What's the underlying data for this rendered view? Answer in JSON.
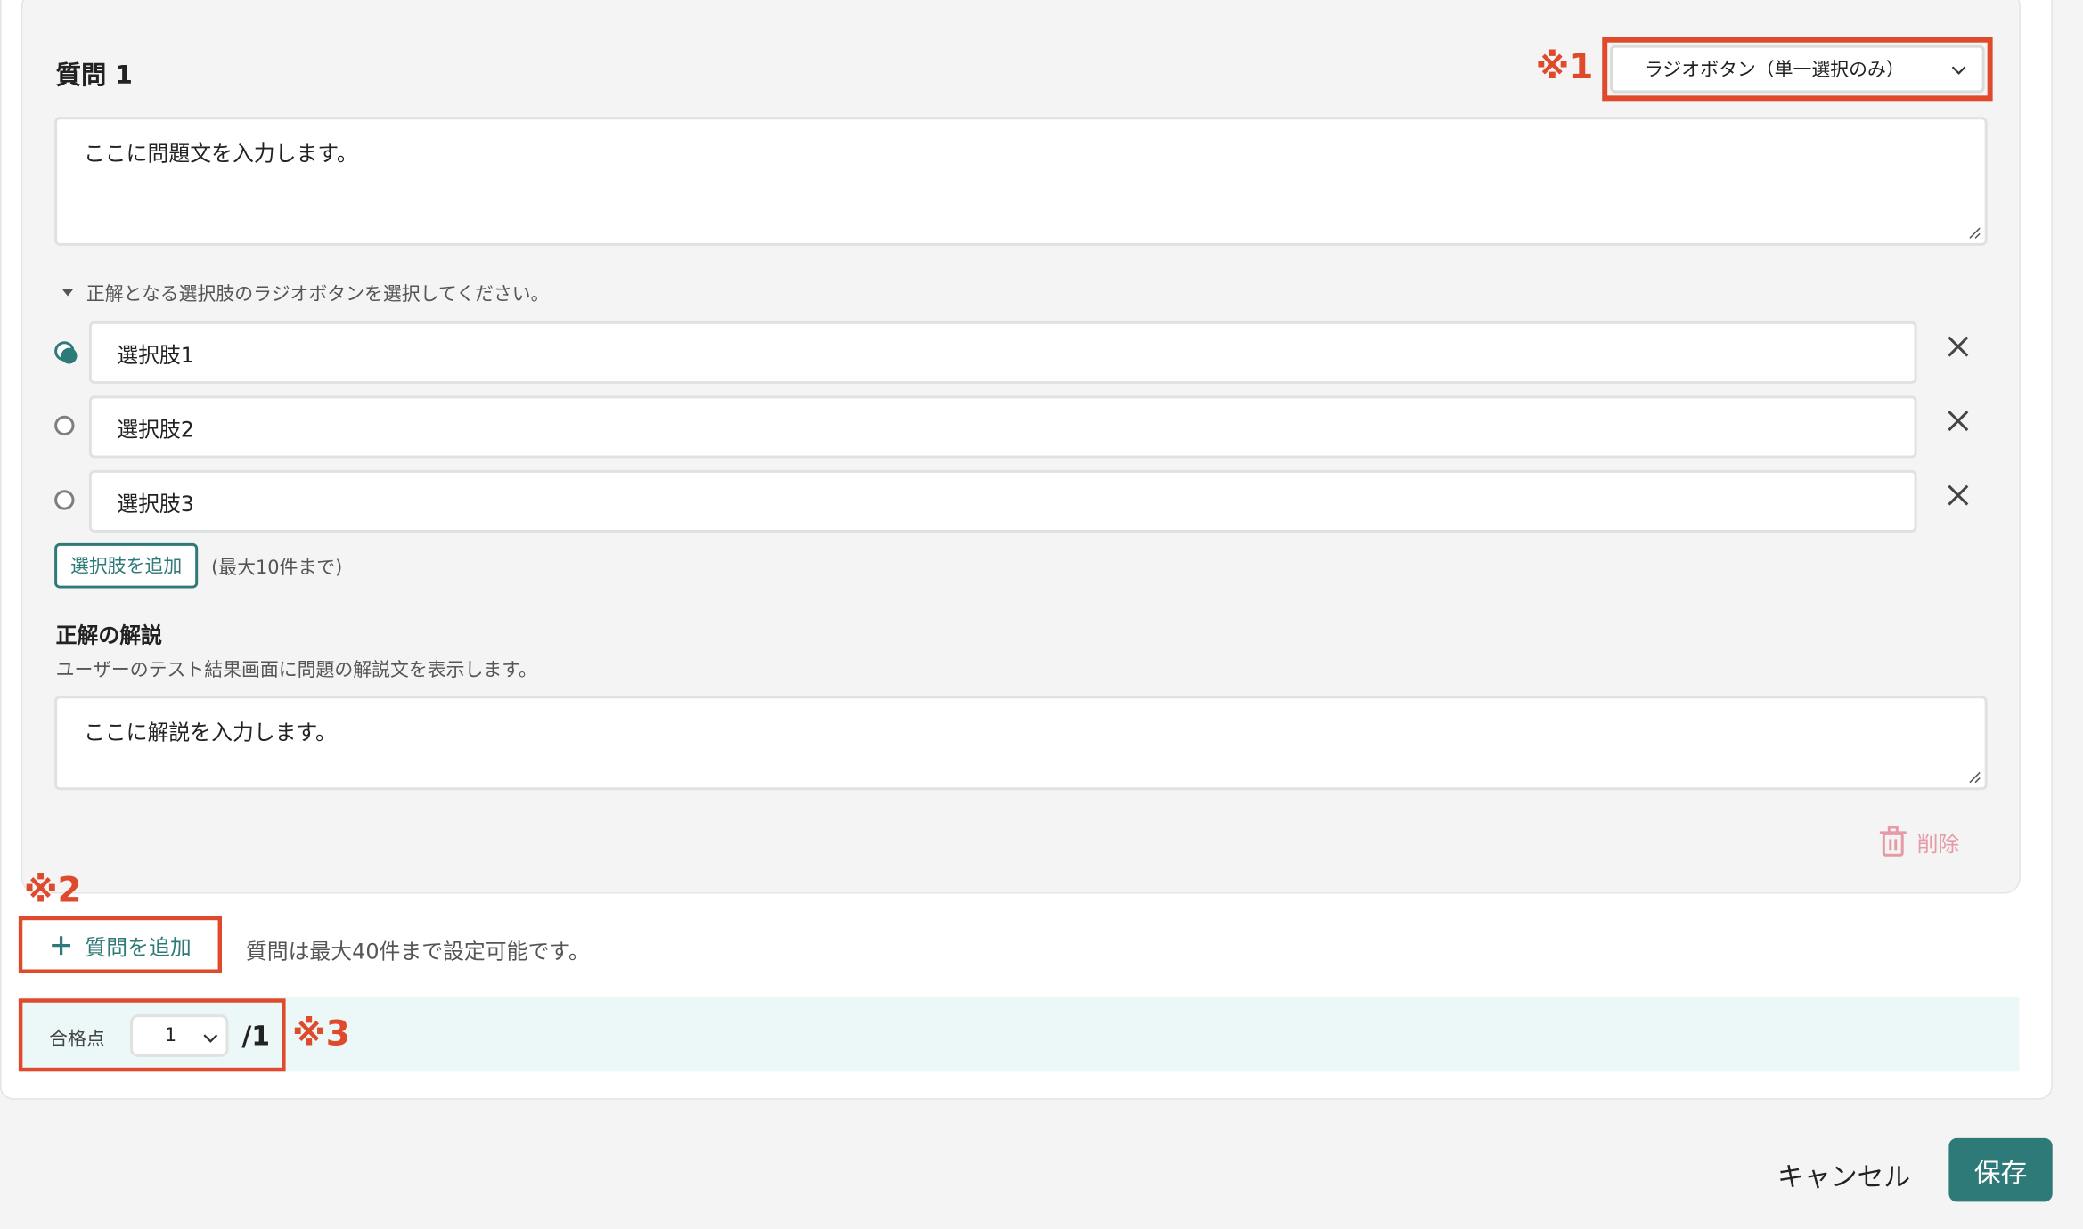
{
  "question": {
    "title": "質問 1",
    "type_select_value": "ラジオボタン（単一選択のみ）",
    "body_text": "ここに問題文を入力します。",
    "choice_hint": "正解となる選択肢のラジオボタンを選択してください。",
    "choices": [
      {
        "label": "選択肢1",
        "selected": true
      },
      {
        "label": "選択肢2",
        "selected": false
      },
      {
        "label": "選択肢3",
        "selected": false
      }
    ],
    "add_choice_label": "選択肢を追加",
    "add_choice_note": "(最大10件まで)",
    "explanation_title": "正解の解説",
    "explanation_desc": "ユーザーのテスト結果画面に問題の解説文を表示します。",
    "explanation_text": "ここに解説を入力します。",
    "delete_label": "削除"
  },
  "add_question": {
    "label": "質問を追加",
    "note": "質問は最大40件まで設定可能です。"
  },
  "pass_score": {
    "label": "合格点",
    "value": "1",
    "total": "/1"
  },
  "annotations": {
    "mark1": "※1",
    "mark2": "※2",
    "mark3": "※3"
  },
  "footer": {
    "cancel_label": "キャンセル",
    "save_label": "保存"
  },
  "colors": {
    "accent": "#2e7a78",
    "annotation_red": "#e04a2c",
    "delete_pink": "#e59aa6",
    "pass_bar_bg": "#ebf8f7"
  }
}
